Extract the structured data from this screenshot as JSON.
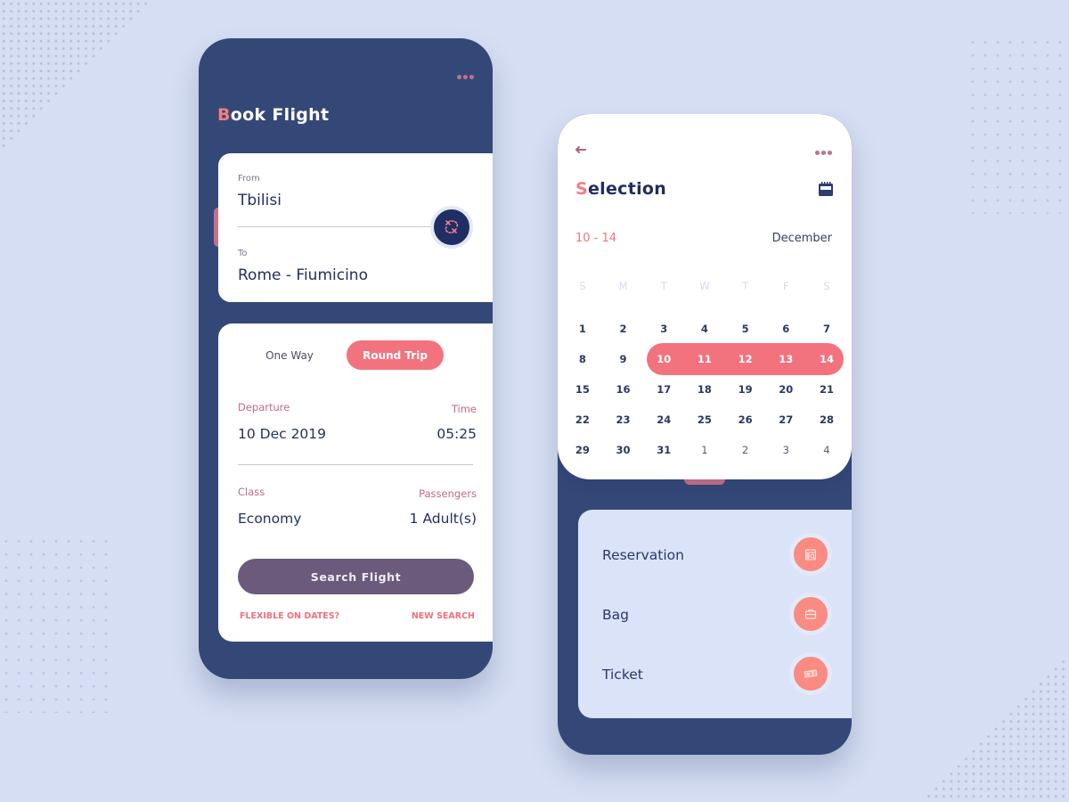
{
  "colors": {
    "background": "#d5def2",
    "navy": "#344878",
    "accent": "#f2737e",
    "pink": "#c46882",
    "button_purple": "#6b5a7c",
    "text_dark": "#1f2e5e"
  },
  "book_flight": {
    "title_first": "B",
    "title_rest": "ook Flight",
    "more_icon": "more-dots-icon",
    "route": {
      "from_label": "From",
      "from_value": "Tbilisi",
      "to_label": "To",
      "to_value": "Rome - Fiumicino",
      "swap_icon": "swap-route-icon"
    },
    "trip_type": {
      "options": [
        "One Way",
        "Round Trip"
      ],
      "selected": "Round Trip"
    },
    "departure_label": "Departure",
    "departure_value": "10 Dec 2019",
    "time_label": "Time",
    "time_value": "05:25",
    "class_label": "Class",
    "class_value": "Economy",
    "passengers_label": "Passengers",
    "passengers_value": "1 Adult(s)",
    "search_button": "Search Flight",
    "flexible_link": "FLEXIBLE ON DATES?",
    "new_search_link": "NEW SEARCH"
  },
  "selection": {
    "back_icon": "arrow-left-icon",
    "more_icon": "more-dots-icon",
    "title_first": "S",
    "title_rest": "election",
    "calendar_icon": "calendar-icon",
    "range": "10 - 14",
    "month": "December",
    "weekdays": [
      "S",
      "M",
      "T",
      "W",
      "T",
      "F",
      "S"
    ],
    "weeks": [
      [
        "1",
        "2",
        "3",
        "4",
        "5",
        "6",
        "7"
      ],
      [
        "8",
        "9",
        "10",
        "11",
        "12",
        "13",
        "14"
      ],
      [
        "15",
        "16",
        "17",
        "18",
        "19",
        "20",
        "21"
      ],
      [
        "22",
        "23",
        "24",
        "25",
        "26",
        "27",
        "28"
      ],
      [
        "29",
        "30",
        "31",
        "1",
        "2",
        "3",
        "4"
      ]
    ],
    "selected_range": {
      "start": 10,
      "end": 14
    },
    "options": [
      {
        "label": "Reservation",
        "icon": "reservation-icon"
      },
      {
        "label": "Bag",
        "icon": "briefcase-icon"
      },
      {
        "label": "Ticket",
        "icon": "ticket-icon"
      }
    ]
  }
}
